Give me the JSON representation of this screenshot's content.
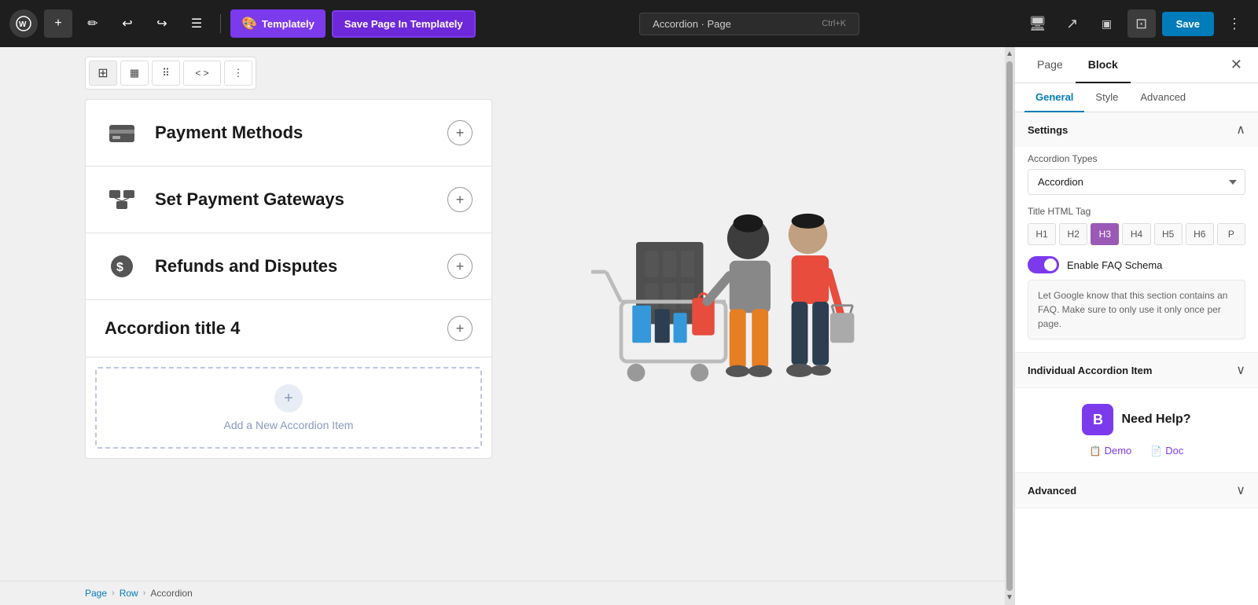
{
  "toolbar": {
    "add_label": "+",
    "pencil_icon": "✏",
    "undo_icon": "↩",
    "redo_icon": "↪",
    "menu_icon": "☰",
    "templately_label": "Templately",
    "save_templately_label": "Save Page In Templately",
    "page_name": "Accordion · Page",
    "shortcut": "Ctrl+K",
    "save_label": "Save",
    "more_icon": "⋮"
  },
  "block_toolbar": {
    "icon1": "⊡",
    "icon2": "▦",
    "icon3": "⠿",
    "icon4": "<>",
    "icon5": "⋮"
  },
  "accordion": {
    "items": [
      {
        "id": 1,
        "title": "Payment Methods",
        "icon": "payment"
      },
      {
        "id": 2,
        "title": "Set Payment Gateways",
        "icon": "gateways"
      },
      {
        "id": 3,
        "title": "Refunds and Disputes",
        "icon": "refunds"
      },
      {
        "id": 4,
        "title": "Accordion title 4",
        "icon": "title4"
      }
    ],
    "add_new_label": "Add a New Accordion Item"
  },
  "breadcrumb": {
    "page": "Page",
    "row": "Row",
    "accordion": "Accordion",
    "sep": "›"
  },
  "panel": {
    "page_tab": "Page",
    "block_tab": "Block",
    "general_tab": "General",
    "style_tab": "Style",
    "advanced_tab": "Advanced",
    "settings_title": "Settings",
    "accordion_types_label": "Accordion Types",
    "accordion_type_value": "Accordion",
    "title_html_tag_label": "Title HTML Tag",
    "html_tags": [
      "H1",
      "H2",
      "H3",
      "H4",
      "H5",
      "H6",
      "P"
    ],
    "active_html_tag": "H3",
    "enable_faq_label": "Enable FAQ Schema",
    "faq_note": "Let Google know that this section contains an FAQ. Make sure to only use it only once per page.",
    "individual_item_label": "Individual Accordion Item",
    "need_help_title": "Need Help?",
    "demo_label": "Demo",
    "doc_label": "Doc",
    "advanced_label": "Advanced"
  }
}
